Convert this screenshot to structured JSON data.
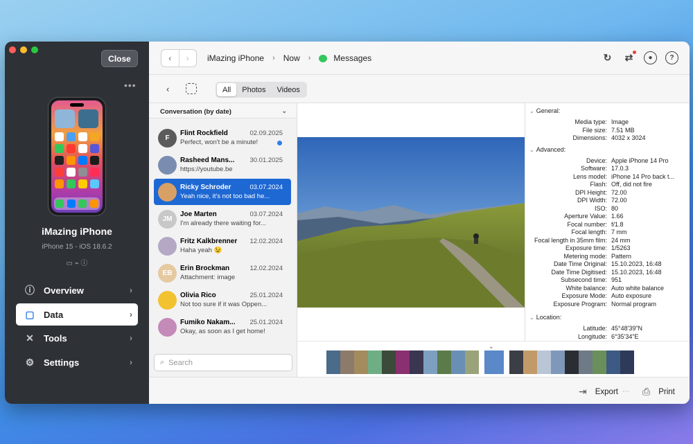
{
  "window": {
    "close_label": "Close",
    "more_label": "•••"
  },
  "device": {
    "name": "iMazing iPhone",
    "subtitle": "iPhone 15 - iOS 18.6.2",
    "status_icons": "▭  ⌁  ⓘ"
  },
  "sidebar": {
    "items": [
      {
        "label": "Overview",
        "icon": "info-icon"
      },
      {
        "label": "Data",
        "icon": "square-icon"
      },
      {
        "label": "Tools",
        "icon": "tools-icon"
      },
      {
        "label": "Settings",
        "icon": "gear-icon"
      }
    ]
  },
  "breadcrumb": {
    "items": [
      "iMazing iPhone",
      "Now",
      "Messages"
    ]
  },
  "toolbar": {
    "segments": [
      "All",
      "Photos",
      "Videos"
    ],
    "selected_segment": "All"
  },
  "conversations": {
    "sort_label": "Conversation (by date)",
    "search_placeholder": "Search",
    "items": [
      {
        "name": "Flint Rockfield",
        "date": "02.09.2025",
        "preview": "Perfect, won't be a minute!",
        "initials": "F",
        "color": "#5b5b5b",
        "unread": true
      },
      {
        "name": "Rasheed Mans...",
        "date": "30.01.2025",
        "preview": "https://youtube.be",
        "initials": "",
        "color": "#7a8db0",
        "unread": false
      },
      {
        "name": "Ricky Schroder",
        "date": "03.07.2024",
        "preview": "Yeah nice, it's not too bad he...",
        "initials": "",
        "color": "#d9a066",
        "unread": false
      },
      {
        "name": "Joe Marten",
        "date": "03.07.2024",
        "preview": "I'm already there waiting for...",
        "initials": "JM",
        "color": "#c8c8c8",
        "unread": false
      },
      {
        "name": "Fritz Kalkbrenner",
        "date": "12.02.2024",
        "preview": "Haha yeah 😉",
        "initials": "",
        "color": "#b4a8c4",
        "unread": false
      },
      {
        "name": "Erin Brockman",
        "date": "12.02.2024",
        "preview": "Attachment: image",
        "initials": "EB",
        "color": "#e5c9a0",
        "unread": false
      },
      {
        "name": "Olivia Rico",
        "date": "25.01.2024",
        "preview": "Not too sure if it was Oppen...",
        "initials": "",
        "color": "#f2c230",
        "unread": false
      },
      {
        "name": "Fumiko Nakam...",
        "date": "25.01.2024",
        "preview": "Okay, as soon as I get home!",
        "initials": "",
        "color": "#c48ab8",
        "unread": false
      }
    ],
    "selected_index": 2
  },
  "info": {
    "general_title": "General:",
    "general": [
      {
        "k": "Media type:",
        "v": "Image"
      },
      {
        "k": "File size:",
        "v": "7.51 MB"
      },
      {
        "k": "Dimensions:",
        "v": "4032 x 3024"
      }
    ],
    "advanced_title": "Advanced:",
    "advanced": [
      {
        "k": "Device:",
        "v": "Apple iPhone 14 Pro"
      },
      {
        "k": "Software:",
        "v": "17.0.3"
      },
      {
        "k": "Lens model:",
        "v": "iPhone 14 Pro back t..."
      },
      {
        "k": "Flash:",
        "v": "Off, did not fire"
      },
      {
        "k": "DPI Height:",
        "v": "72.00"
      },
      {
        "k": "DPI Width:",
        "v": "72.00"
      },
      {
        "k": "ISO:",
        "v": "80"
      },
      {
        "k": "Aperture Value:",
        "v": "1.66"
      },
      {
        "k": "Focal number:",
        "v": "f/1.8"
      },
      {
        "k": "Focal length:",
        "v": "7 mm"
      },
      {
        "k": "Focal length in 35mm film:",
        "v": "24 mm"
      },
      {
        "k": "Exposure time:",
        "v": "1/5263"
      },
      {
        "k": "Metering mode:",
        "v": "Pattern"
      },
      {
        "k": "Date Time Original:",
        "v": "15.10.2023, 16:48"
      },
      {
        "k": "Date Time Digitised:",
        "v": "15.10.2023, 16:48"
      },
      {
        "k": "Subsecond time:",
        "v": "951"
      },
      {
        "k": "White balance:",
        "v": "Auto white balance"
      },
      {
        "k": "Exposure Mode:",
        "v": "Auto exposure"
      },
      {
        "k": "Exposure Program:",
        "v": "Normal program"
      }
    ],
    "location_title": "Location:",
    "location": [
      {
        "k": "Latitude:",
        "v": "45°48'39\"N"
      },
      {
        "k": "Longitude:",
        "v": "6°35'34\"E"
      }
    ]
  },
  "bottombar": {
    "export_label": "Export",
    "print_label": "Print"
  },
  "colors": {
    "accent": "#1e68d3",
    "sidebar_bg": "#2e3136"
  }
}
